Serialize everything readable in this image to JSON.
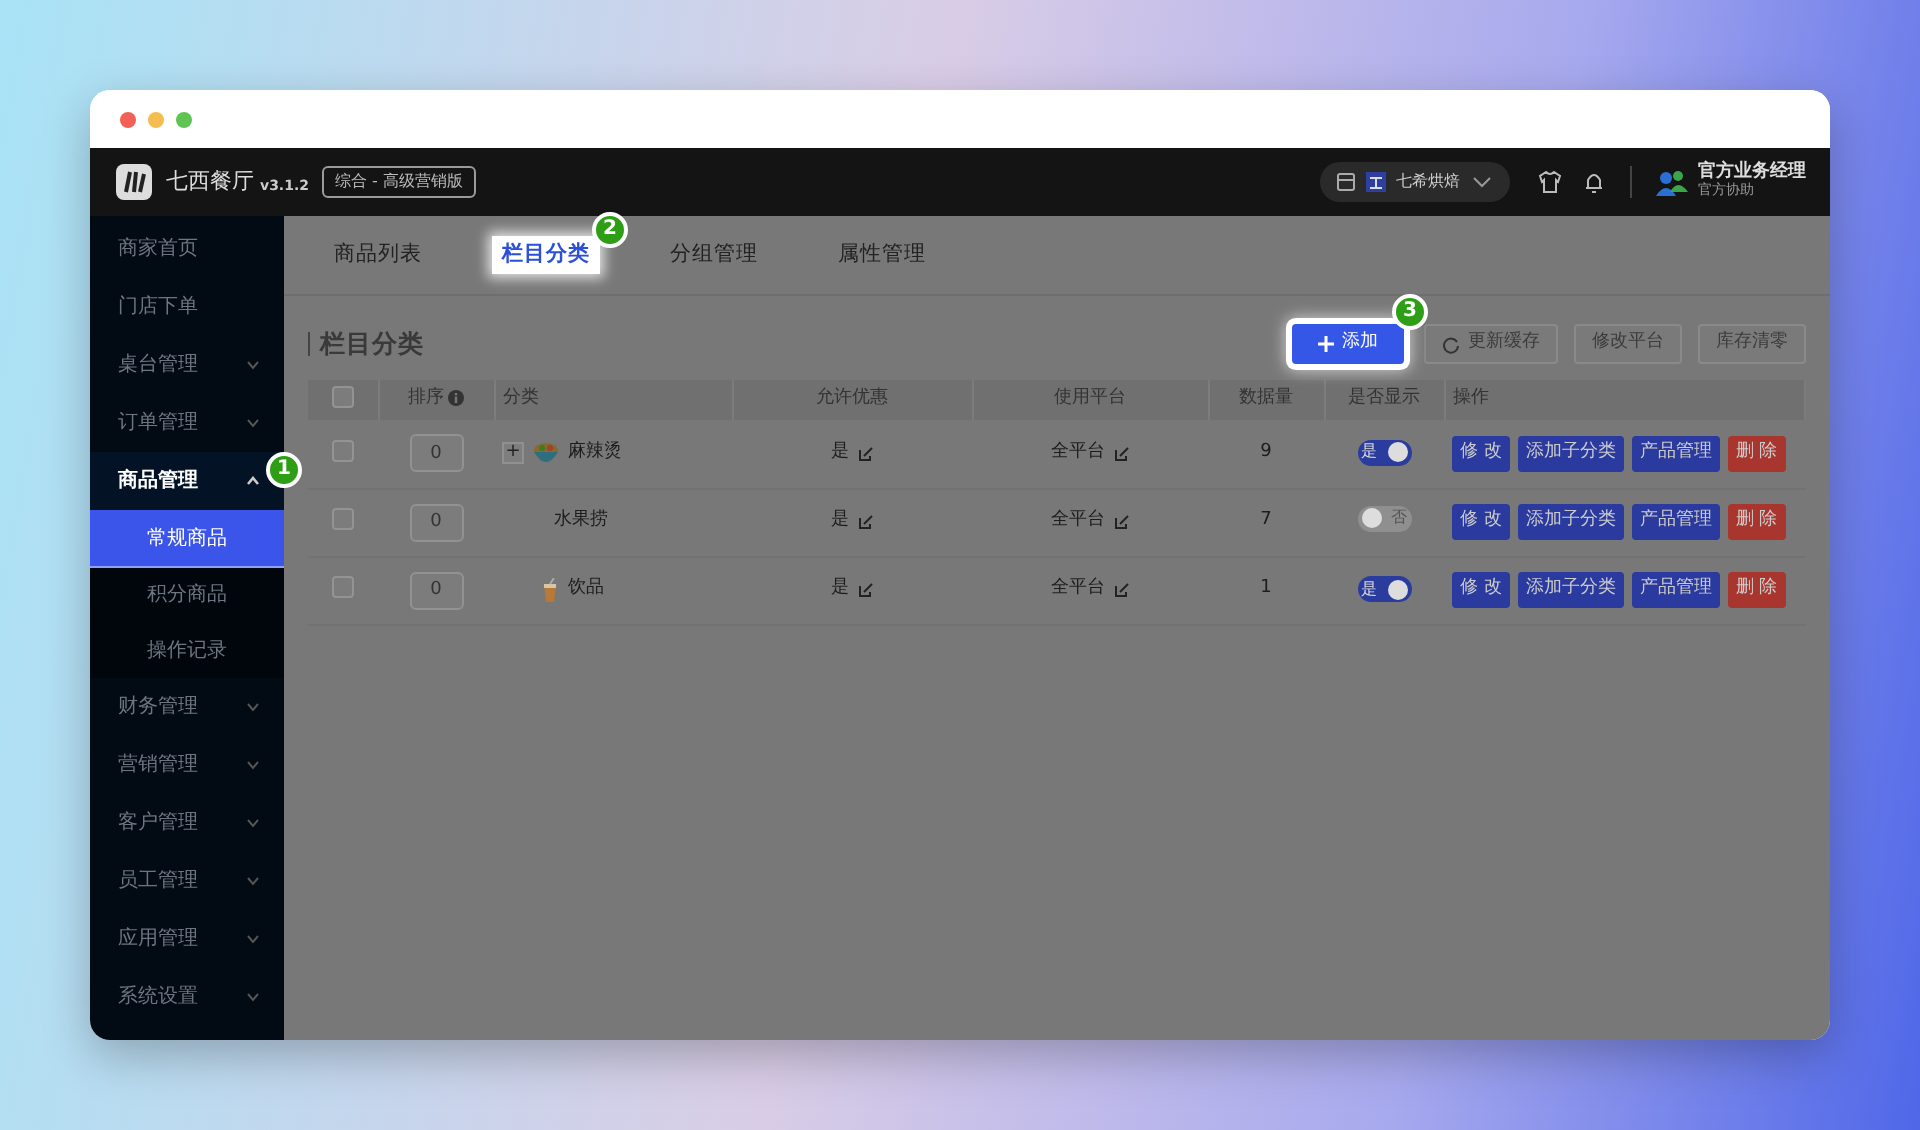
{
  "app": {
    "name": "七西餐厅",
    "version": "v3.1.2",
    "edition": "综合 - 高级营销版"
  },
  "header": {
    "store": "七希烘焙",
    "user_name": "官方业务经理",
    "user_role": "官方协助"
  },
  "sidebar": {
    "items": [
      {
        "label": "商家首页",
        "kind": "link"
      },
      {
        "label": "门店下单",
        "kind": "link"
      },
      {
        "label": "桌台管理",
        "kind": "group",
        "expanded": false
      },
      {
        "label": "订单管理",
        "kind": "group",
        "expanded": false
      },
      {
        "label": "商品管理",
        "kind": "group",
        "expanded": true,
        "highlighted": true,
        "step": "1",
        "children": [
          {
            "label": "常规商品",
            "selected": true
          },
          {
            "label": "积分商品",
            "selected": false
          },
          {
            "label": "操作记录",
            "selected": false
          }
        ]
      },
      {
        "label": "财务管理",
        "kind": "group",
        "expanded": false
      },
      {
        "label": "营销管理",
        "kind": "group",
        "expanded": false
      },
      {
        "label": "客户管理",
        "kind": "group",
        "expanded": false
      },
      {
        "label": "员工管理",
        "kind": "group",
        "expanded": false
      },
      {
        "label": "应用管理",
        "kind": "group",
        "expanded": false
      },
      {
        "label": "系统设置",
        "kind": "group",
        "expanded": false
      }
    ]
  },
  "tabs": [
    {
      "label": "商品列表",
      "selected": false,
      "highlighted": false
    },
    {
      "label": "栏目分类",
      "selected": true,
      "highlighted": true,
      "step": "2"
    },
    {
      "label": "分组管理",
      "selected": false,
      "highlighted": false
    },
    {
      "label": "属性管理",
      "selected": false,
      "highlighted": false
    }
  ],
  "section_title": "栏目分类",
  "toolbar": [
    {
      "label": "添加",
      "kind": "add",
      "highlighted": true,
      "step": "3"
    },
    {
      "label": "更新缓存",
      "kind": "refresh",
      "highlighted": false
    },
    {
      "label": "修改平台",
      "kind": "plain",
      "highlighted": false
    },
    {
      "label": "库存清零",
      "kind": "plain",
      "highlighted": false
    }
  ],
  "table": {
    "select_all_checked": false,
    "columns": [
      {
        "kind": "checkbox"
      },
      {
        "label": "排序",
        "kind": "info"
      },
      {
        "label": "分类",
        "kind": "left"
      },
      {
        "label": "允许优惠",
        "kind": "center"
      },
      {
        "label": "使用平台",
        "kind": "center"
      },
      {
        "label": "数据量",
        "kind": "center"
      },
      {
        "label": "是否显示",
        "kind": "center"
      },
      {
        "label": "操作",
        "kind": "left"
      }
    ],
    "rows": [
      {
        "checked": false,
        "sort": "0",
        "expand_symbol": "+",
        "kind": "bowl",
        "name": "麻辣烫",
        "discount": "是",
        "platform": "全平台",
        "count": "9",
        "visible": true,
        "visible_label": "是",
        "actions": [
          {
            "label": "修 改",
            "kind": "primary"
          },
          {
            "label": "添加子分类",
            "kind": "primary"
          },
          {
            "label": "产品管理",
            "kind": "primary"
          },
          {
            "label": "删 除",
            "kind": "danger"
          }
        ]
      },
      {
        "checked": false,
        "sort": "0",
        "kind": "plain",
        "name": "水果捞",
        "discount": "是",
        "platform": "全平台",
        "count": "7",
        "visible": false,
        "visible_label": "否",
        "actions": [
          {
            "label": "修 改",
            "kind": "primary"
          },
          {
            "label": "添加子分类",
            "kind": "primary"
          },
          {
            "label": "产品管理",
            "kind": "primary"
          },
          {
            "label": "删 除",
            "kind": "danger"
          }
        ]
      },
      {
        "checked": false,
        "sort": "0",
        "kind": "cup",
        "name": "饮品",
        "discount": "是",
        "platform": "全平台",
        "count": "1",
        "visible": true,
        "visible_label": "是",
        "actions": [
          {
            "label": "修 改",
            "kind": "primary"
          },
          {
            "label": "添加子分类",
            "kind": "primary"
          },
          {
            "label": "产品管理",
            "kind": "primary"
          },
          {
            "label": "删 除",
            "kind": "danger"
          }
        ]
      }
    ]
  }
}
